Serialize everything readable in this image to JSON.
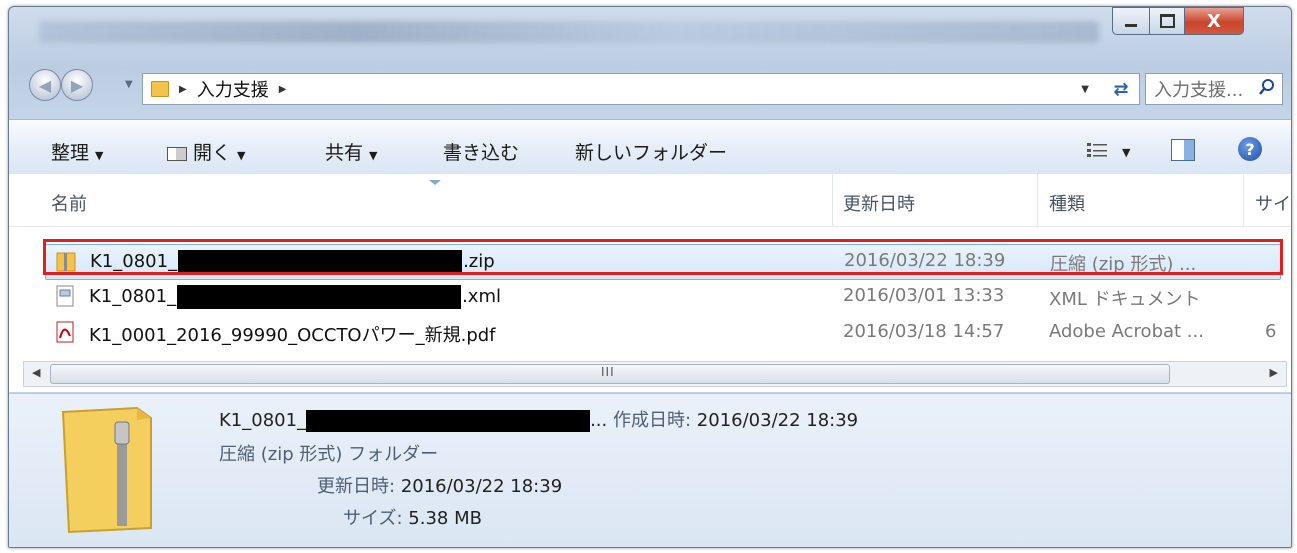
{
  "window": {
    "close_glyph": "X"
  },
  "address": {
    "crumb": "入力支援",
    "search_placeholder": "入力支援..."
  },
  "toolbar": {
    "organize": "整理",
    "open": "開く",
    "share": "共有",
    "burn": "書き込む",
    "new_folder": "新しいフォルダー"
  },
  "columns": {
    "name": "名前",
    "date": "更新日時",
    "type": "種類",
    "size": "サイ"
  },
  "files": [
    {
      "name_prefix": "K1_0801_",
      "name_suffix": ".zip",
      "redacted": true,
      "date": "2016/03/22 18:39",
      "type": "圧縮 (zip 形式) ...",
      "size": "",
      "icon": "zip-folder-icon",
      "selected": true
    },
    {
      "name_prefix": "K1_0801_",
      "name_suffix": ".xml",
      "redacted": true,
      "date": "2016/03/01 13:33",
      "type": "XML ドキュメント",
      "size": "",
      "icon": "xml-file-icon",
      "selected": false
    },
    {
      "name_prefix": "K1_0001_2016_99990_OCCTOパワー_新規.pdf",
      "name_suffix": "",
      "redacted": false,
      "date": "2016/03/18 14:57",
      "type": "Adobe Acrobat ...",
      "size": "6",
      "icon": "pdf-file-icon",
      "selected": false
    }
  ],
  "scrollbar": {
    "grip": "III"
  },
  "details": {
    "name_prefix": "K1_0801_",
    "name_ellipsis": "...",
    "created_label": "作成日時:",
    "created_value": "2016/03/22 18:39",
    "type_text": "圧縮 (zip 形式) フォルダー",
    "modified_label": "更新日時:",
    "modified_value": "2016/03/22 18:39",
    "size_label": "サイズ:",
    "size_value": "5.38 MB"
  },
  "colors": {
    "highlight_border": "#e0201e",
    "selection_fill": "#d6e7fa",
    "folder_yellow": "#f3c34a"
  }
}
